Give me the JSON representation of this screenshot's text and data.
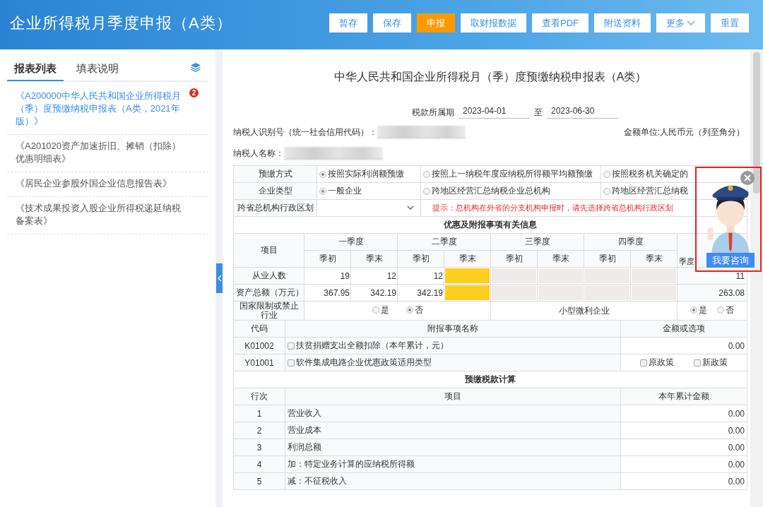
{
  "header": {
    "title": "企业所得税月季度申报（A类）",
    "buttons": [
      {
        "label": "暂存",
        "kind": "normal"
      },
      {
        "label": "保存",
        "kind": "normal"
      },
      {
        "label": "申报",
        "kind": "primary"
      },
      {
        "label": "取财报数据",
        "kind": "normal"
      },
      {
        "label": "查看PDF",
        "kind": "normal"
      },
      {
        "label": "附送资料",
        "kind": "normal"
      },
      {
        "label": "更多",
        "kind": "dropdown"
      },
      {
        "label": "重置",
        "kind": "normal"
      }
    ]
  },
  "sidebar": {
    "tabs": [
      {
        "label": "报表列表",
        "selected": true
      },
      {
        "label": "填表说明",
        "selected": false
      }
    ],
    "items": [
      {
        "title": "《A200000中华人民共和国企业所得税月（季）度预缴纳税申报表（A类，2021年版）》",
        "selected": true,
        "badge": "2"
      },
      {
        "title": "《A201020资产加速折旧、摊销（扣除）优惠明细表》",
        "selected": false
      },
      {
        "title": "《居民企业参股外国企业信息报告表》",
        "selected": false
      },
      {
        "title": "《技术成果投资入股企业所得税递延纳税备案表》",
        "selected": false
      }
    ]
  },
  "form": {
    "title": "中华人民共和国企业所得税月（季）度预缴纳税申报表（A类）",
    "period_label": "税款所属期",
    "period_from": "2023-04-01",
    "period_sep": "至",
    "period_to": "2023-06-30",
    "taxpayer_id_label": "纳税人识别号（统一社会信用代码）：",
    "unit": "金额单位:人民币元（列至角分）",
    "taxpayer_name_label": "纳税人名称："
  },
  "method_rows": [
    {
      "label": "预缴方式",
      "options": [
        {
          "label": "按照实际利润额预缴",
          "selected": true
        },
        {
          "label": "按照上一纳税年度应纳税所得额平均额预缴",
          "selected": false
        },
        {
          "label": "按照税务机关确定的",
          "selected": false
        }
      ]
    },
    {
      "label": "企业类型",
      "options": [
        {
          "label": "一般企业",
          "selected": true
        },
        {
          "label": "跨地区经营汇总纳税企业总机构",
          "selected": false
        },
        {
          "label": "跨地区经营汇总纳税",
          "selected": false
        }
      ]
    }
  ],
  "region": {
    "label": "跨省总机构行政区划",
    "hint": "提示：总机构在外省的分支机构申报时，请先选择跨省总机构行政区划"
  },
  "benefits": {
    "title": "优惠及附报事项有关信息",
    "item_header": "项目",
    "quarters": [
      {
        "label": "一季度",
        "sub": [
          "季初",
          "季末"
        ]
      },
      {
        "label": "二季度",
        "sub": [
          "季初",
          "季末"
        ]
      },
      {
        "label": "三季度",
        "sub": [
          "季初",
          "季末"
        ]
      },
      {
        "label": "四季度",
        "sub": [
          "季初",
          "季末"
        ]
      }
    ],
    "average_header": "季度",
    "rows": [
      {
        "label": "从业人数",
        "cells": [
          {
            "kind": "input",
            "value": "19"
          },
          {
            "kind": "input",
            "value": "12"
          },
          {
            "kind": "input",
            "value": "12"
          },
          {
            "kind": "highlight"
          },
          {
            "kind": "disabled"
          },
          {
            "kind": "disabled"
          },
          {
            "kind": "disabled"
          },
          {
            "kind": "disabled"
          }
        ],
        "average": "11"
      },
      {
        "label": "资产总额（万元）",
        "cells": [
          {
            "kind": "input",
            "value": "367.95"
          },
          {
            "kind": "input",
            "value": "342.19"
          },
          {
            "kind": "input",
            "value": "342.19"
          },
          {
            "kind": "highlight"
          },
          {
            "kind": "disabled"
          },
          {
            "kind": "disabled"
          },
          {
            "kind": "disabled"
          },
          {
            "kind": "disabled"
          }
        ],
        "average": "263.08"
      }
    ],
    "restricted": {
      "label": "国家限制或禁止行业",
      "options": [
        {
          "label": "是",
          "selected": false
        },
        {
          "label": "否",
          "selected": true
        }
      ]
    },
    "small": {
      "label": "小型微利企业",
      "options": [
        {
          "label": "是",
          "selected": true
        },
        {
          "label": "否",
          "selected": false
        }
      ]
    }
  },
  "attached": {
    "headers": [
      "代码",
      "附报事项名称",
      "金额或选项"
    ],
    "rows": [
      {
        "kind": "amount",
        "code": "K01002",
        "name": "扶贫捐赠支出全额扣除（本年累计，元）",
        "checked": false,
        "amount": "0.00"
      },
      {
        "kind": "choice",
        "code": "Y01001",
        "name": "软件集成电路企业优惠政策适用类型",
        "checked": false,
        "options": [
          {
            "label": "原政策",
            "checked": false
          },
          {
            "label": "新政策",
            "checked": false
          }
        ]
      }
    ]
  },
  "calc": {
    "title": "预缴税款计算",
    "headers": [
      "行次",
      "项目",
      "本年累计金额"
    ],
    "rows": [
      {
        "no": "1",
        "item": "营业收入",
        "amount": "0.00"
      },
      {
        "no": "2",
        "item": "营业成本",
        "amount": "0.00"
      },
      {
        "no": "3",
        "item": "利润总额",
        "amount": "0.00"
      },
      {
        "no": "4",
        "item": "加：特定业务计算的应纳税所得额",
        "amount": "0.00"
      },
      {
        "no": "5",
        "item": "减：不征税收入",
        "amount": "0.00"
      }
    ]
  },
  "assistant": {
    "button": "我要咨询"
  }
}
